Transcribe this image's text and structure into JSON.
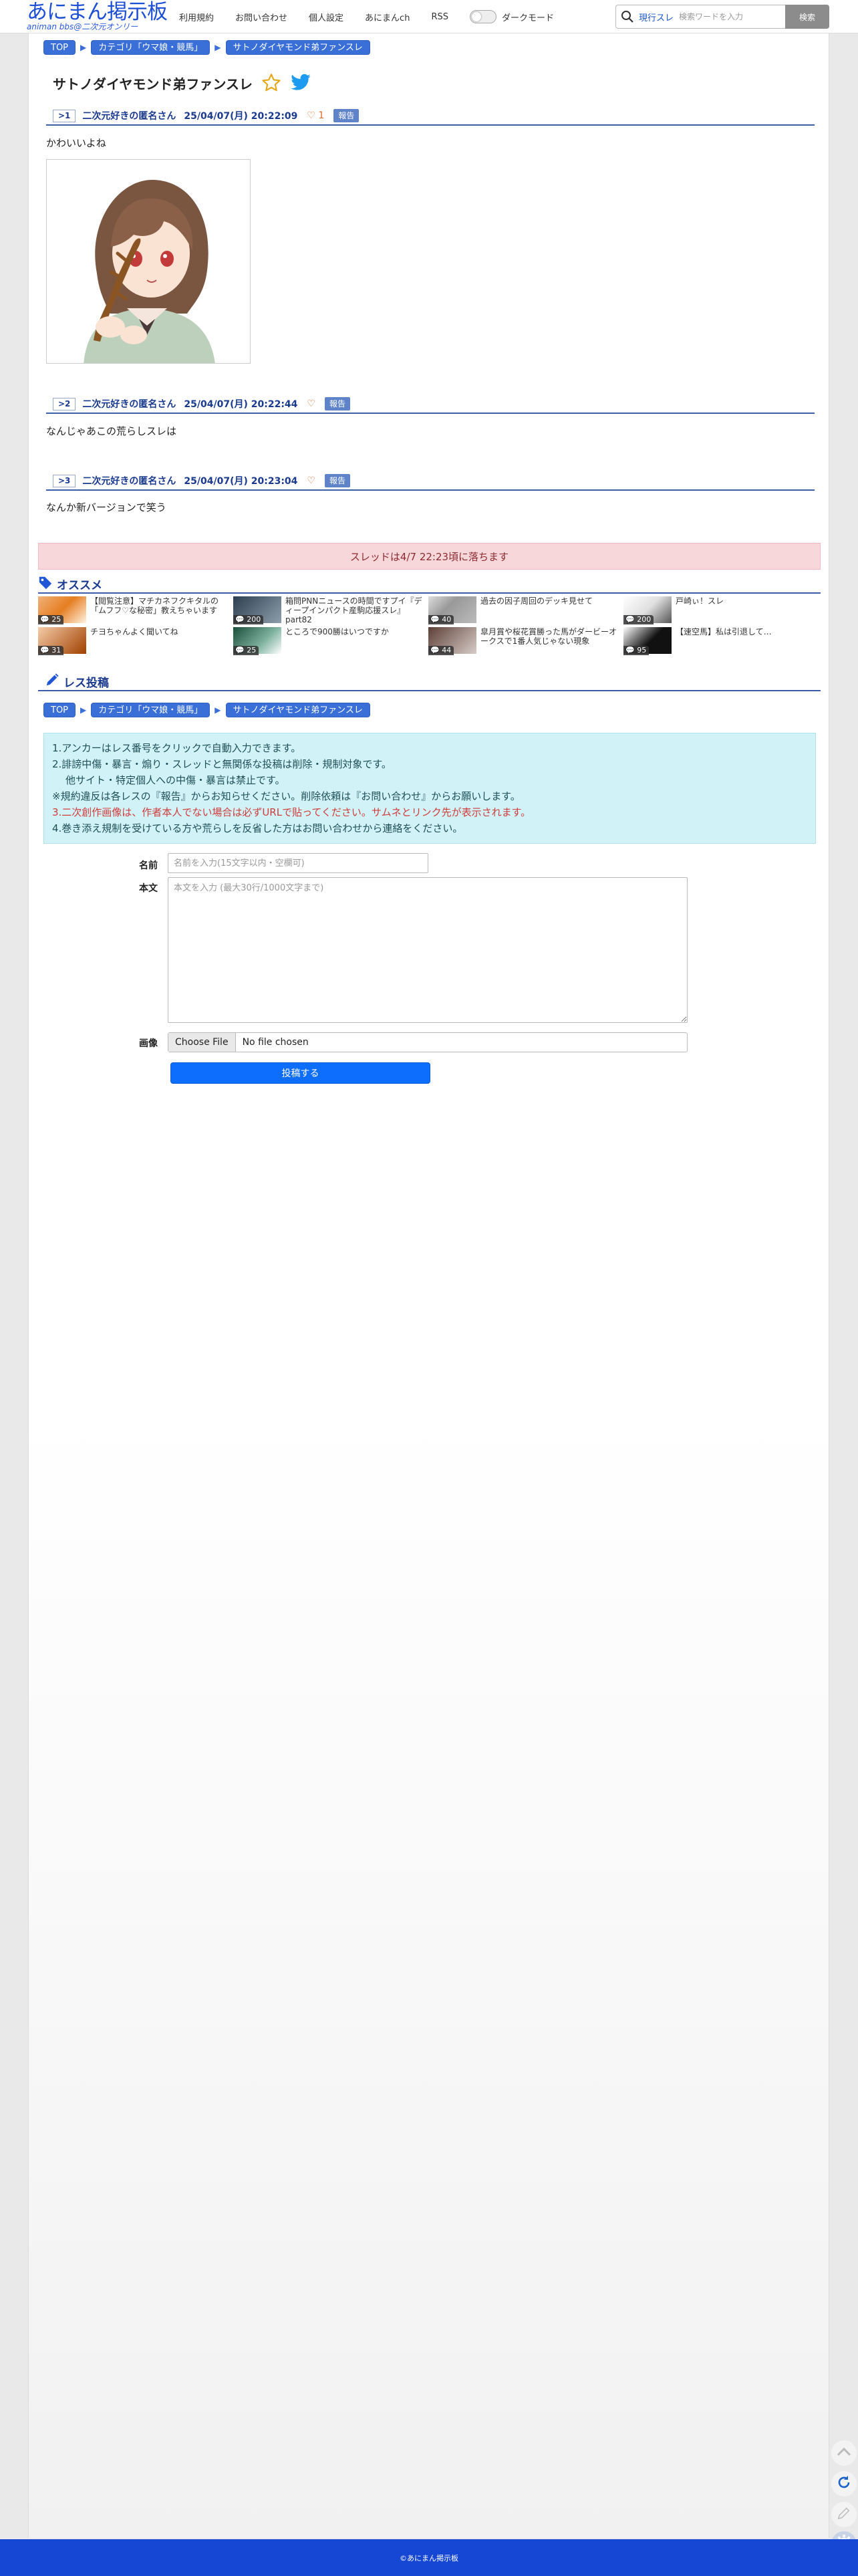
{
  "header": {
    "logo_main": "あにまん掲示板",
    "logo_sub": "animan bbs@二次元オンリー",
    "nav": [
      "利用規約",
      "お問い合わせ",
      "個人設定",
      "あにまんch",
      "RSS"
    ],
    "dark_mode_label": "ダークモード",
    "search_mode": "現行スレ",
    "search_placeholder": "検索ワードを入力",
    "search_button": "検索"
  },
  "breadcrumb": [
    "TOP",
    "カテゴリ「ウマ娘・競馬」",
    "サトノダイヤモンド弟ファンスレ"
  ],
  "thread": {
    "title": "サトノダイヤモンド弟ファンスレ",
    "icons": [
      "star-icon",
      "twitter-bird-icon"
    ],
    "end_notice": "スレッドは4/7 22:23頃に落ちます"
  },
  "posts": [
    {
      "num": ">1",
      "name": "二次元好きの匿名さん",
      "date": "25/04/07(月) 20:22:09",
      "likes": "♡ 1",
      "report": "報告",
      "body": "かわいいよね"
    },
    {
      "num": ">2",
      "name": "二次元好きの匿名さん",
      "date": "25/04/07(月) 20:22:44",
      "likes": "♡",
      "report": "報告",
      "body": "なんじゃあこの荒らしスレは"
    },
    {
      "num": ">3",
      "name": "二次元好きの匿名さん",
      "date": "25/04/07(月) 20:23:04",
      "likes": "♡",
      "report": "報告",
      "body": "なんか新バージョンで笑う"
    }
  ],
  "recommend": {
    "title": "オススメ",
    "items": [
      {
        "count": "25",
        "title": "【閲覧注意】マチカネフクキタルの「ムフフ♡な秘密」教えちゃいます"
      },
      {
        "count": "200",
        "title": "箱問PNNニュースの時間ですプイ『ディープインパクト産駒応援スレ』part82"
      },
      {
        "count": "40",
        "title": "過去の因子周回のデッキ見せて"
      },
      {
        "count": "200",
        "title": "戸崎ぃ！スレ"
      },
      {
        "count": "31",
        "title": "チヨちゃんよく聞いてね"
      },
      {
        "count": "25",
        "title": "ところで900勝はいつですか"
      },
      {
        "count": "44",
        "title": "皐月賞や桜花賞勝った馬がダービーオークスで1番人気じゃない現象"
      },
      {
        "count": "95",
        "title": "【速空馬】私は引退して…"
      }
    ]
  },
  "reply": {
    "title": "レス投稿",
    "notice": [
      "1.アンカーはレス番号をクリックで自動入力できます。",
      "2.誹謗中傷・暴言・煽り・スレッドと無関係な投稿は削除・規制対象です。",
      "他サイト・特定個人への中傷・暴言は禁止です。",
      "※規約違反は各レスの『報告』からお知らせください。削除依頼は『お問い合わせ』からお願いします。",
      "3.二次創作画像は、作者本人でない場合は必ずURLで貼ってください。サムネとリンク先が表示されます。",
      "4.巻き添え規制を受けている方や荒らしを反省した方はお問い合わせから連絡をください。"
    ],
    "name_label": "名前",
    "name_placeholder": "名前を入力(15文字以内・空欄可)",
    "body_label": "本文",
    "body_placeholder": "本文を入力 (最大30行/1000文字まで)",
    "image_label": "画像",
    "file_button": "Choose File",
    "file_status": "No file chosen",
    "submit": "投稿する"
  },
  "footer": "©あにまん掲示板",
  "colors": {
    "brand": "#1c4fd6",
    "accent": "#3d5ea8",
    "notice_bg": "#d1f3f7",
    "end_notice_bg": "#f8d7da",
    "submit": "#0d6efd"
  }
}
